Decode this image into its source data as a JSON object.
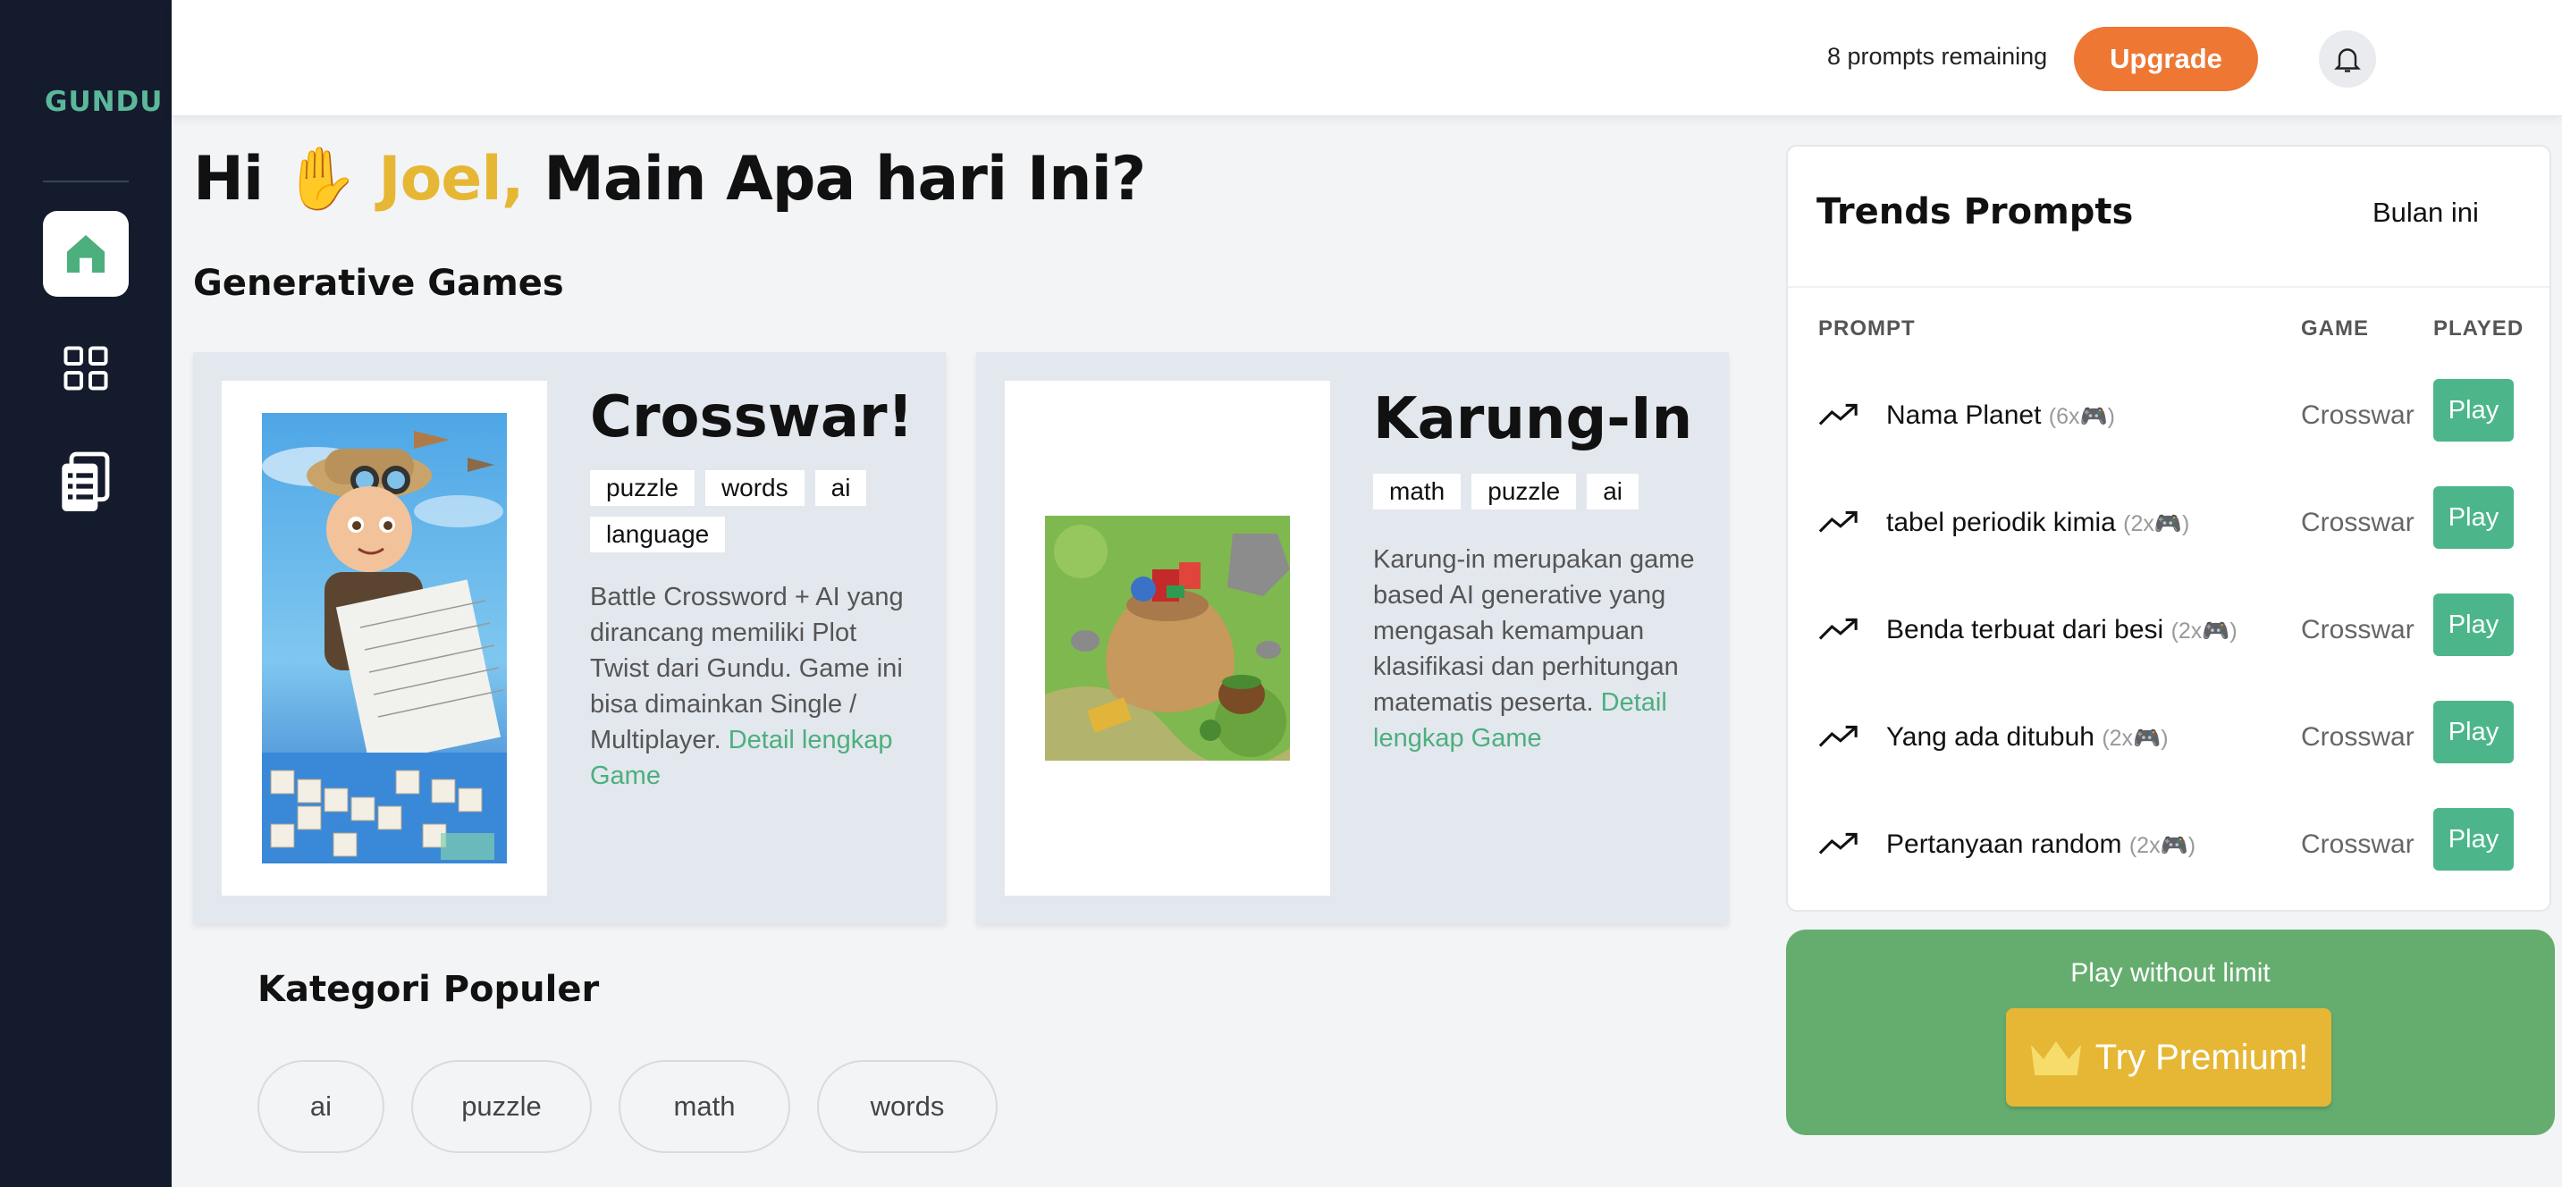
{
  "sidebar": {
    "logo": "GUNDU",
    "nav": [
      {
        "name": "home",
        "icon": "home-icon",
        "active": true
      },
      {
        "name": "grid",
        "icon": "grid-icon",
        "active": false
      },
      {
        "name": "list",
        "icon": "clipboard-list-icon",
        "active": false
      }
    ]
  },
  "header": {
    "prompts_remaining": "8 prompts remaining",
    "upgrade_label": "Upgrade",
    "bell_icon": "bell-icon",
    "avatar_icon": "android-avatar"
  },
  "main": {
    "greeting_prefix": "Hi",
    "greeting_emoji": "✋",
    "greeting_name": "Joel,",
    "greeting_suffix": "Main Apa hari Ini?",
    "section_title": "Generative Games",
    "games": [
      {
        "title": "Crosswar!",
        "tags": [
          "puzzle",
          "words",
          "ai",
          "language"
        ],
        "description": "Battle Crossword + AI yang dirancang memiliki Plot Twist dari Gundu. Game ini bisa dimainkan Single / Multiplayer.",
        "link": "Detail lengkap Game"
      },
      {
        "title": "Karung-In",
        "tags": [
          "math",
          "puzzle",
          "ai"
        ],
        "description": "Karung-in merupakan game based AI generative yang mengasah kemampuan klasifikasi dan perhitungan matematis peserta.",
        "link": "Detail lengkap Game"
      }
    ],
    "kategori_title": "Kategori Populer",
    "categories": [
      "ai",
      "puzzle",
      "math",
      "words"
    ]
  },
  "trends": {
    "title": "Trends Prompts",
    "period": "Bulan ini",
    "columns": {
      "prompt": "PROMPT",
      "game": "GAME",
      "played": "PLAYED"
    },
    "rows": [
      {
        "prompt": "Nama Planet",
        "count": "(6x",
        "game": "Crosswar",
        "action": "Play"
      },
      {
        "prompt": "tabel periodik kimia",
        "count": "(2x",
        "game": "Crosswar",
        "action": "Play"
      },
      {
        "prompt": "Benda terbuat dari besi",
        "count": "(2x",
        "game": "Crosswar",
        "action": "Play"
      },
      {
        "prompt": "Yang ada ditubuh",
        "count": "(2x",
        "game": "Crosswar",
        "action": "Play"
      },
      {
        "prompt": "Pertanyaan random",
        "count": "(2x",
        "game": "Crosswar",
        "action": "Play"
      }
    ]
  },
  "premium": {
    "label": "Play without limit",
    "button": "Try Premium!"
  },
  "colors": {
    "sidebar": "#131b2c",
    "accent_orange": "#ee7734",
    "accent_green": "#4cb68a",
    "accent_yellow": "#e6b735",
    "premium_bg": "#65ad6f"
  }
}
